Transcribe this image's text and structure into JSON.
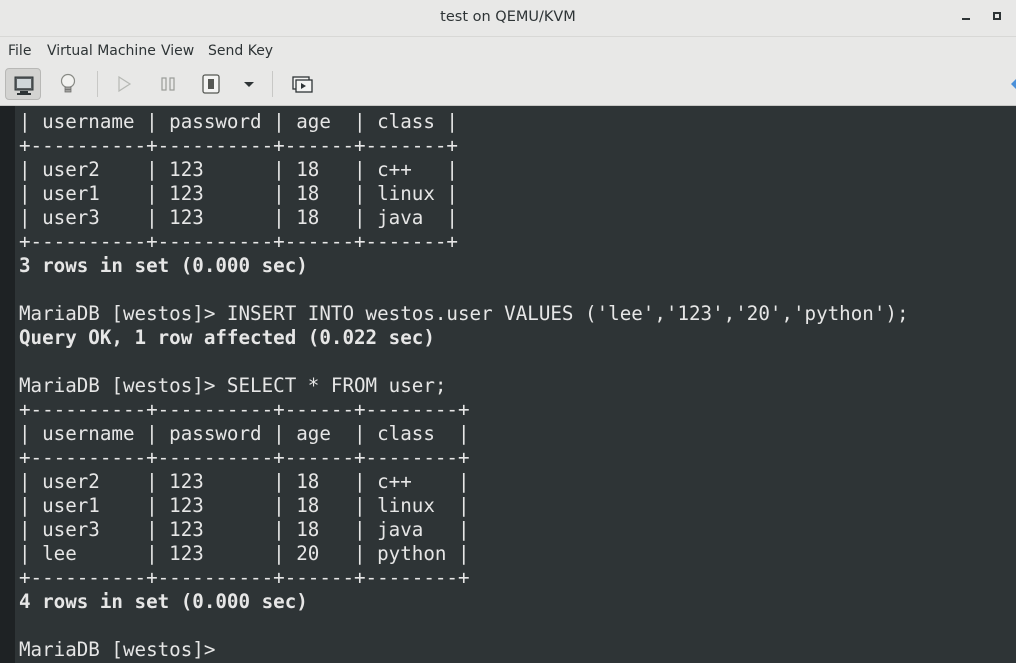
{
  "window": {
    "title": "test on QEMU/KVM"
  },
  "menubar": {
    "items": [
      "File",
      "Virtual Machine",
      "View",
      "Send Key"
    ]
  },
  "toolbar": {
    "buttons": [
      "monitor-icon",
      "lightbulb-icon",
      "play-icon",
      "pause-icon",
      "power-icon",
      "dropdown-icon",
      "screens-icon"
    ]
  },
  "terminal": {
    "lines": [
      {
        "text": "| username | password | age  | class |",
        "bold": false
      },
      {
        "text": "+----------+----------+------+-------+",
        "bold": false
      },
      {
        "text": "| user2    | 123      | 18   | c++   |",
        "bold": false
      },
      {
        "text": "| user1    | 123      | 18   | linux |",
        "bold": false
      },
      {
        "text": "| user3    | 123      | 18   | java  |",
        "bold": false
      },
      {
        "text": "+----------+----------+------+-------+",
        "bold": false
      },
      {
        "text": "3 rows in set (0.000 sec)",
        "bold": true
      },
      {
        "text": "",
        "bold": false
      },
      {
        "text": "MariaDB [westos]> INSERT INTO westos.user VALUES ('lee','123','20','python');",
        "bold": false
      },
      {
        "text": "Query OK, 1 row affected (0.022 sec)",
        "bold": true
      },
      {
        "text": "",
        "bold": false
      },
      {
        "text": "MariaDB [westos]> SELECT * FROM user;",
        "bold": false
      },
      {
        "text": "+----------+----------+------+--------+",
        "bold": false
      },
      {
        "text": "| username | password | age  | class  |",
        "bold": false
      },
      {
        "text": "+----------+----------+------+--------+",
        "bold": false
      },
      {
        "text": "| user2    | 123      | 18   | c++    |",
        "bold": false
      },
      {
        "text": "| user1    | 123      | 18   | linux  |",
        "bold": false
      },
      {
        "text": "| user3    | 123      | 18   | java   |",
        "bold": false
      },
      {
        "text": "| lee      | 123      | 20   | python |",
        "bold": false
      },
      {
        "text": "+----------+----------+------+--------+",
        "bold": false
      },
      {
        "text": "4 rows in set (0.000 sec)",
        "bold": true
      },
      {
        "text": "",
        "bold": false
      },
      {
        "text": "MariaDB [westos]> ",
        "bold": false
      }
    ]
  },
  "colors": {
    "terminal_bg": "#2e3436",
    "terminal_fg": "#e6e6e6",
    "chrome_bg": "#e8e8e7"
  }
}
